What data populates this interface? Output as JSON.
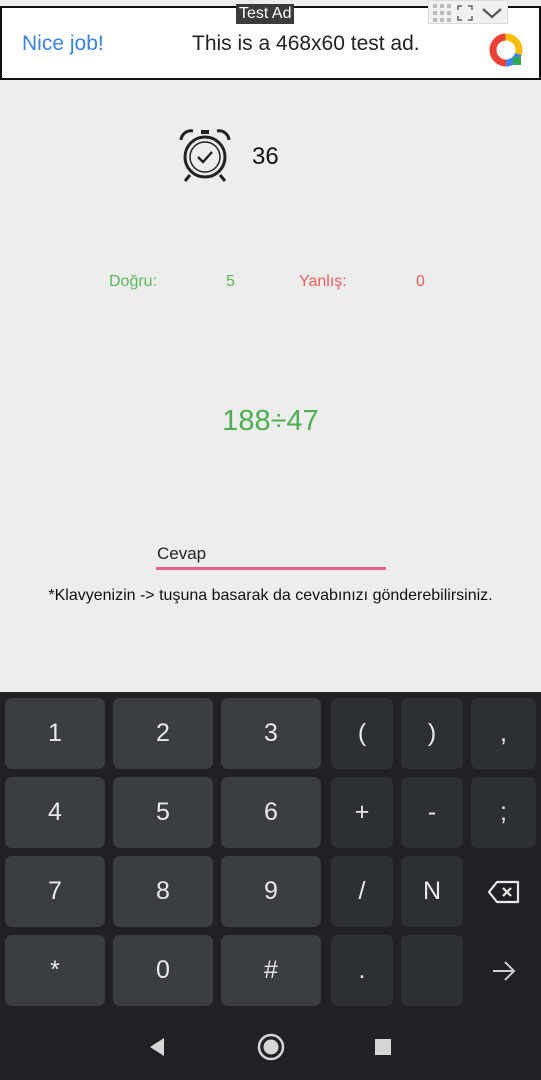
{
  "ad": {
    "tag": "Test Ad",
    "left_text": "Nice job!",
    "center_text": "This is a 468x60 test ad."
  },
  "timer": {
    "icon": "alarm-clock-icon",
    "value": "36"
  },
  "score": {
    "correct_label": "Doğru:",
    "correct_value": "5",
    "wrong_label": "Yanlış:",
    "wrong_value": "0",
    "correct_color": "#5cb85c",
    "wrong_color": "#ef5b5b"
  },
  "question": {
    "text": "188÷47",
    "color": "#4caf50"
  },
  "answer": {
    "placeholder": "Cevap",
    "value": "",
    "underline_color": "#e8608f"
  },
  "hint": "*Klavyenizin -> tuşuna basarak da cevabınızı gönderebilirsiniz.",
  "keyboard": {
    "rows": [
      [
        "1",
        "2",
        "3",
        "(",
        ")",
        ","
      ],
      [
        "4",
        "5",
        "6",
        "+",
        "-",
        ";"
      ],
      [
        "7",
        "8",
        "9",
        "/",
        "N",
        "backspace-icon"
      ],
      [
        "*",
        "0",
        "#",
        ".",
        "",
        "enter-arrow-icon"
      ]
    ]
  },
  "navbar": {
    "back": "back-triangle-icon",
    "home": "home-circle-icon",
    "recents": "recents-square-icon"
  }
}
